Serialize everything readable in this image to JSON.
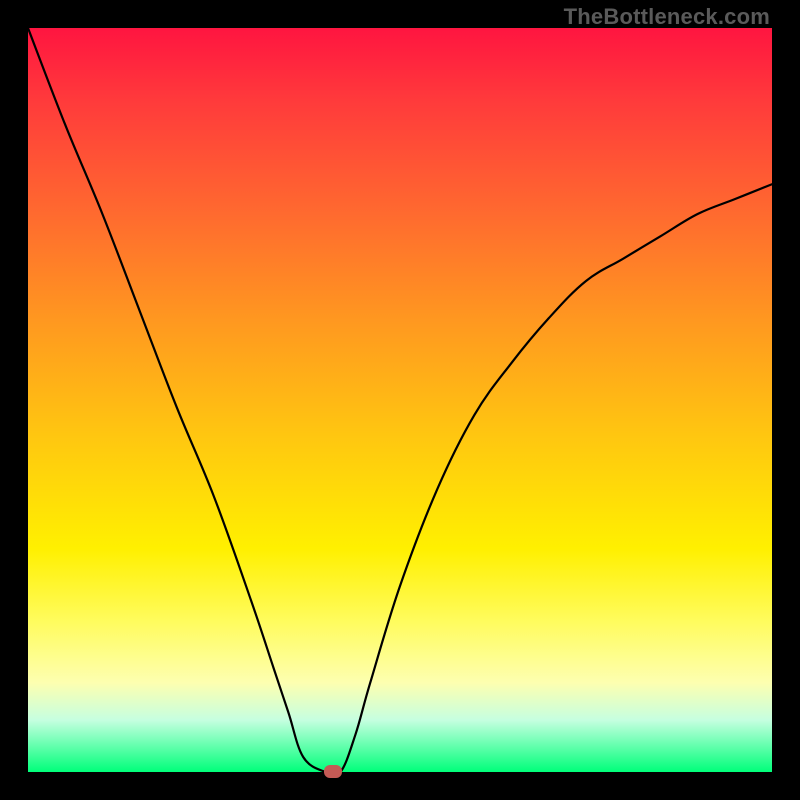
{
  "watermark": "TheBottleneck.com",
  "chart_data": {
    "type": "line",
    "title": "",
    "xlabel": "",
    "ylabel": "",
    "xlim": [
      0,
      100
    ],
    "ylim": [
      0,
      100
    ],
    "grid": false,
    "series": [
      {
        "name": "curve",
        "x": [
          0,
          5,
          10,
          15,
          20,
          25,
          30,
          33,
          35,
          37,
          40,
          42,
          44,
          46,
          50,
          55,
          60,
          65,
          70,
          75,
          80,
          85,
          90,
          95,
          100
        ],
        "values": [
          100,
          87,
          75,
          62,
          49,
          37,
          23,
          14,
          8,
          2,
          0,
          0,
          5,
          12,
          25,
          38,
          48,
          55,
          61,
          66,
          69,
          72,
          75,
          77,
          79
        ]
      }
    ],
    "marker": {
      "x": 41,
      "y": 0,
      "color": "#c45a55"
    },
    "background_gradient": {
      "top_color": "#ff1540",
      "bottom_color": "#00ff7a"
    }
  }
}
